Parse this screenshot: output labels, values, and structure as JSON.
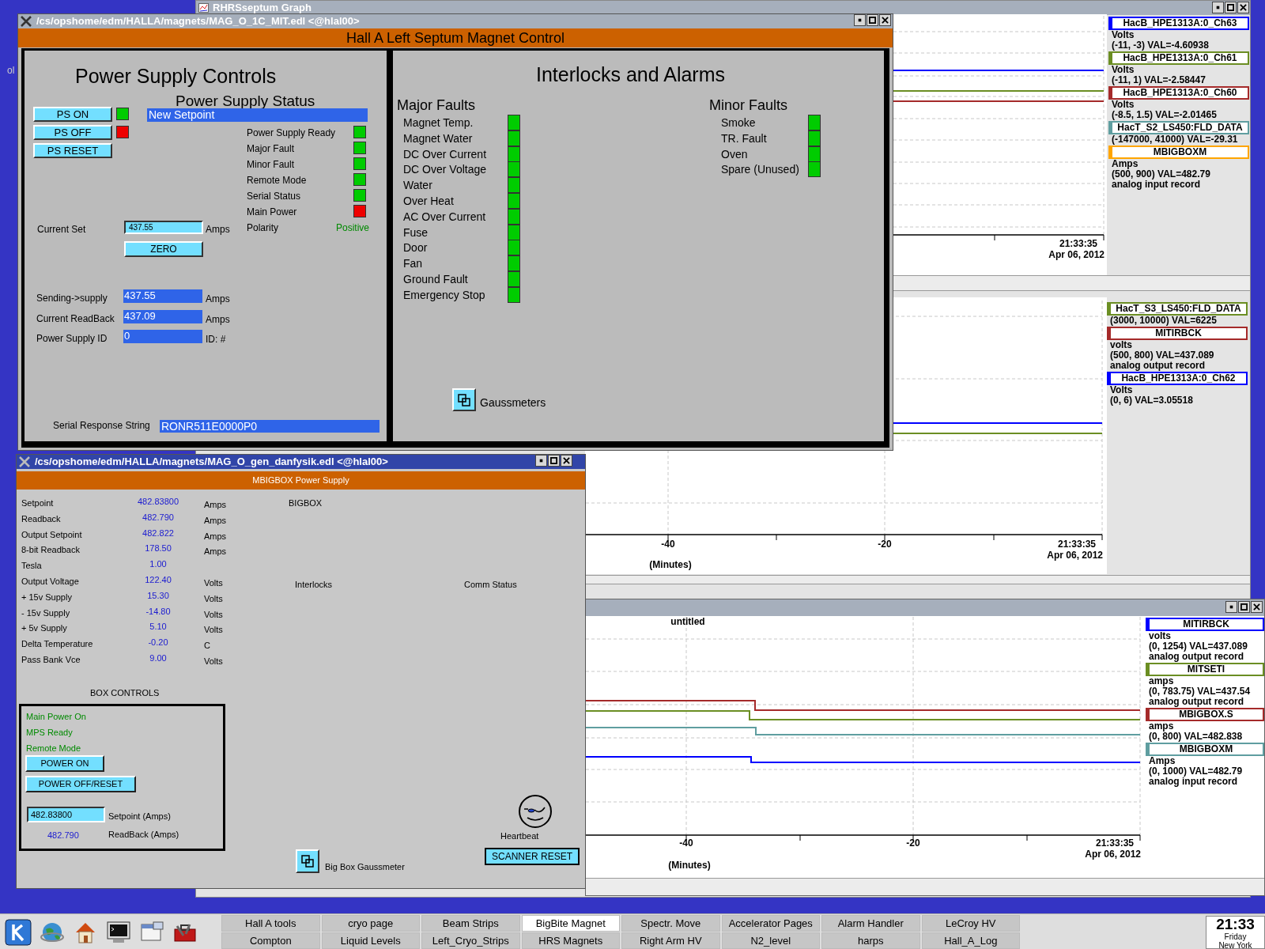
{
  "desktop": {
    "icon_label": "ol"
  },
  "graph_window": {
    "title": "RHRSseptum Graph"
  },
  "graphs": [
    {
      "time": "21:33:35",
      "date": "Apr 06, 2012",
      "legend": [
        {
          "name": "HacB_HPE1313A:0_Ch63",
          "color": "#0000ff",
          "lines": [
            "Volts",
            "(-11, -3) VAL=-4.60938"
          ]
        },
        {
          "name": "HacB_HPE1313A:0_Ch61",
          "color": "#6b8e23",
          "lines": [
            "Volts",
            "(-11, 1) VAL=-2.58447"
          ]
        },
        {
          "name": "HacB_HPE1313A:0_Ch60",
          "color": "#a52a2a",
          "lines": [
            "Volts",
            "(-8.5, 1.5) VAL=-2.01465"
          ]
        },
        {
          "name": "HacT_S2_LS450:FLD_DATA",
          "color": "#5f9ea0",
          "lines": [
            "(-147000, 41000) VAL=-29.31"
          ]
        },
        {
          "name": "MBIGBOXM",
          "color": "#ffa500",
          "lines": [
            "Amps",
            "(500, 900) VAL=482.79",
            "analog input record"
          ]
        }
      ]
    },
    {
      "time": "21:33:35",
      "date": "Apr 06, 2012",
      "xticks": [
        "-40",
        "-20"
      ],
      "xlabel": "(Minutes)",
      "legend": [
        {
          "name": "HacT_S3_LS450:FLD_DATA",
          "color": "#6b8e23",
          "lines": [
            "(3000, 10000) VAL=6225"
          ]
        },
        {
          "name": "MITIRBCK",
          "color": "#a52a2a",
          "lines": [
            "volts",
            "(500, 800) VAL=437.089",
            "analog output record"
          ]
        },
        {
          "name": "HacB_HPE1313A:0_Ch62",
          "color": "#0000ff",
          "lines": [
            "Volts",
            "(0, 6) VAL=3.05518"
          ]
        }
      ]
    },
    {
      "title": "untitled",
      "time": "21:33:35",
      "date": "Apr 06, 2012",
      "xticks": [
        "-40",
        "-20"
      ],
      "xlabel": "(Minutes)",
      "legend": [
        {
          "name": "MITIRBCK",
          "color": "#0000ff",
          "lines": [
            "volts",
            "(0, 1254) VAL=437.089",
            "analog output record"
          ]
        },
        {
          "name": "MITSETI",
          "color": "#6b8e23",
          "lines": [
            "amps",
            "(0, 783.75) VAL=437.54",
            "analog output record"
          ]
        },
        {
          "name": "MBIGBOX.S",
          "color": "#a52a2a",
          "lines": [
            "amps",
            "(0, 800) VAL=482.838"
          ]
        },
        {
          "name": "MBIGBOXM",
          "color": "#5f9ea0",
          "lines": [
            "Amps",
            "(0, 1000) VAL=482.79",
            "analog input record"
          ]
        }
      ]
    }
  ],
  "septum_window": {
    "title": "/cs/opshome/edm/HALLA/magnets/MAG_O_1C_MIT.edl <@hlal00>",
    "header": "Hall A Left Septum Magnet Control",
    "controls_heading": "Power Supply Controls",
    "ps_buttons": [
      {
        "label": "PS ON",
        "color": "#00cc00"
      },
      {
        "label": "PS OFF",
        "color": "#ee0000"
      },
      {
        "label": "PS RESET"
      }
    ],
    "status_heading": "Power Supply Status",
    "status_message": "New Setpoint",
    "status_items": [
      {
        "label": "Power Supply Ready",
        "color": "#00cc00"
      },
      {
        "label": "Major Fault",
        "color": "#00cc00"
      },
      {
        "label": "Minor Fault",
        "color": "#00cc00"
      },
      {
        "label": "Remote Mode",
        "color": "#00cc00"
      },
      {
        "label": "Serial Status",
        "color": "#00cc00"
      },
      {
        "label": "Main Power",
        "color": "#ee0000"
      }
    ],
    "polarity": {
      "label": "Polarity",
      "value": "Positive",
      "color": "#008a00"
    },
    "current_set": {
      "label": "Current Set",
      "value": "437.55",
      "unit": "Amps"
    },
    "zero_button": "ZERO",
    "readouts": [
      {
        "label": "Sending->supply",
        "value": "437.55",
        "unit": "Amps"
      },
      {
        "label": "Current ReadBack",
        "value": "437.09",
        "unit": "Amps"
      },
      {
        "label": "Power Supply ID",
        "value": "0",
        "unit": "ID: #"
      }
    ],
    "serial": {
      "label": "Serial Response String",
      "value": "RONR511E0000P0"
    },
    "interlocks_heading": "Interlocks and Alarms",
    "major_faults": {
      "heading": "Major Faults",
      "items": [
        {
          "label": "Magnet Temp.",
          "color": "#00cc00"
        },
        {
          "label": "Magnet Water",
          "color": "#00cc00"
        },
        {
          "label": "DC Over Current",
          "color": "#00cc00"
        },
        {
          "label": "DC Over Voltage",
          "color": "#00cc00"
        },
        {
          "label": "Water",
          "color": "#00cc00"
        },
        {
          "label": "Over Heat",
          "color": "#00cc00"
        },
        {
          "label": "AC Over Current",
          "color": "#00cc00"
        },
        {
          "label": "Fuse",
          "color": "#00cc00"
        },
        {
          "label": "Door",
          "color": "#00cc00"
        },
        {
          "label": "Fan",
          "color": "#00cc00"
        },
        {
          "label": "Ground Fault",
          "color": "#00cc00"
        },
        {
          "label": "Emergency Stop",
          "color": "#00cc00"
        }
      ]
    },
    "minor_faults": {
      "heading": "Minor Faults",
      "items": [
        {
          "label": "Smoke",
          "color": "#00cc00"
        },
        {
          "label": "TR. Fault",
          "color": "#00cc00"
        },
        {
          "label": "Oven",
          "color": "#00cc00"
        },
        {
          "label": "Spare (Unused)",
          "color": "#00cc00"
        }
      ]
    },
    "gaussmeters_label": "Gaussmeters"
  },
  "danfysik_window": {
    "title": "/cs/opshome/edm/HALLA/magnets/MAG_O_gen_danfysik.edl <@hlal00>",
    "header": "MBIGBOX Power Supply",
    "readings": [
      {
        "label": "Setpoint",
        "value": "482.83800",
        "unit": "Amps"
      },
      {
        "label": "Readback",
        "value": "482.790",
        "unit": "Amps"
      },
      {
        "label": "Output Setpoint",
        "value": "482.822",
        "unit": "Amps"
      },
      {
        "label": "8-bit Readback",
        "value": "178.50",
        "unit": "Amps"
      },
      {
        "label": "Tesla",
        "value": "1.00"
      },
      {
        "label": "Output Voltage",
        "value": "122.40",
        "unit": "Volts"
      },
      {
        "label": "+ 15v Supply",
        "value": "15.30",
        "unit": "Volts"
      },
      {
        "label": "- 15v Supply",
        "value": "-14.80",
        "unit": "Volts"
      },
      {
        "label": "+ 5v Supply",
        "value": "5.10",
        "unit": "Volts"
      },
      {
        "label": "Delta Temperature",
        "value": "-0.20",
        "unit": "C"
      },
      {
        "label": "Pass Bank Vce",
        "value": "9.00",
        "unit": "Volts"
      }
    ],
    "bigbox_label": "BIGBOX",
    "interlocks_label": "Interlocks",
    "comm_status_label": "Comm Status",
    "box_controls": {
      "heading": "BOX CONTROLS",
      "statuses": [
        {
          "label": "Main Power On",
          "color": "#008a00"
        },
        {
          "label": "MPS Ready",
          "color": "#008a00"
        },
        {
          "label": "Remote Mode",
          "color": "#008a00"
        }
      ],
      "buttons": [
        "POWER ON",
        "POWER OFF/RESET"
      ],
      "setpoint_value": "482.83800",
      "setpoint_label": "Setpoint (Amps)",
      "readback_value": "482.790",
      "readback_label": "ReadBack (Amps)"
    },
    "heartbeat_label": "Heartbeat",
    "scanner_reset": "SCANNER RESET",
    "gaussmeter_label": "Big Box Gaussmeter"
  },
  "taskbar": {
    "tasks": [
      {
        "label": "Hall A tools",
        "selected": false
      },
      {
        "label": "cryo page",
        "selected": false
      },
      {
        "label": "Beam Strips",
        "selected": false
      },
      {
        "label": "BigBite Magnet",
        "selected": true
      },
      {
        "label": "Spectr. Move",
        "selected": false
      },
      {
        "label": "Accelerator Pages",
        "selected": false
      },
      {
        "label": "Alarm Handler",
        "selected": false
      },
      {
        "label": "LeCroy HV",
        "selected": false
      },
      {
        "label": "Compton",
        "selected": false
      },
      {
        "label": "Liquid Levels",
        "selected": false
      },
      {
        "label": "Left_Cryo_Strips",
        "selected": false
      },
      {
        "label": "HRS Magnets",
        "selected": false
      },
      {
        "label": "Right Arm HV",
        "selected": false
      },
      {
        "label": "N2_level",
        "selected": false
      },
      {
        "label": "harps",
        "selected": false
      },
      {
        "label": "Hall_A_Log",
        "selected": false
      }
    ],
    "clock": {
      "time": "21:33",
      "day": "Friday",
      "zone": "New York"
    }
  }
}
